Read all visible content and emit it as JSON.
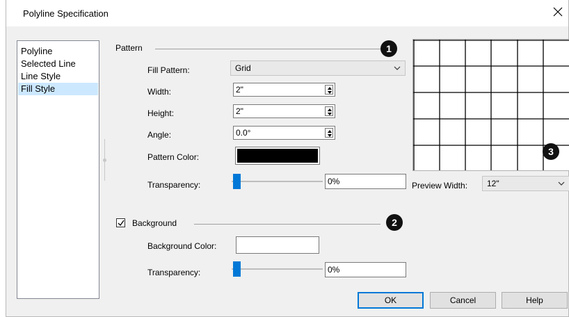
{
  "window": {
    "title": "Polyline Specification",
    "close_glyph": "✕"
  },
  "sidebar": {
    "items": [
      {
        "label": "Polyline",
        "selected": false
      },
      {
        "label": "Selected Line",
        "selected": false
      },
      {
        "label": "Line Style",
        "selected": false
      },
      {
        "label": "Fill Style",
        "selected": true
      }
    ]
  },
  "pattern": {
    "group_label": "Pattern",
    "badge": "1",
    "fill_pattern": {
      "label": "Fill Pattern:",
      "value": "Grid"
    },
    "width": {
      "label": "Width:",
      "value": "2\""
    },
    "height": {
      "label": "Height:",
      "value": "2\""
    },
    "angle": {
      "label": "Angle:",
      "value": "0.0°"
    },
    "pattern_color": {
      "label": "Pattern Color:",
      "color": "#000000"
    },
    "transparency": {
      "label": "Transparency:",
      "value": "0%",
      "level": 0
    }
  },
  "background": {
    "group_label": "Background",
    "badge": "2",
    "checked": true,
    "background_color": {
      "label": "Background Color:",
      "color": "#ffffff"
    },
    "transparency": {
      "label": "Transparency:",
      "value": "0%",
      "level": 0
    }
  },
  "preview": {
    "badge": "3",
    "width_label": "Preview Width:",
    "width_value": "12\""
  },
  "buttons": {
    "ok": "OK",
    "cancel": "Cancel",
    "help": "Help"
  },
  "colors": {
    "accent": "#0078d7",
    "selection": "#cce8ff",
    "dialog_bg": "#f0f0f0"
  }
}
